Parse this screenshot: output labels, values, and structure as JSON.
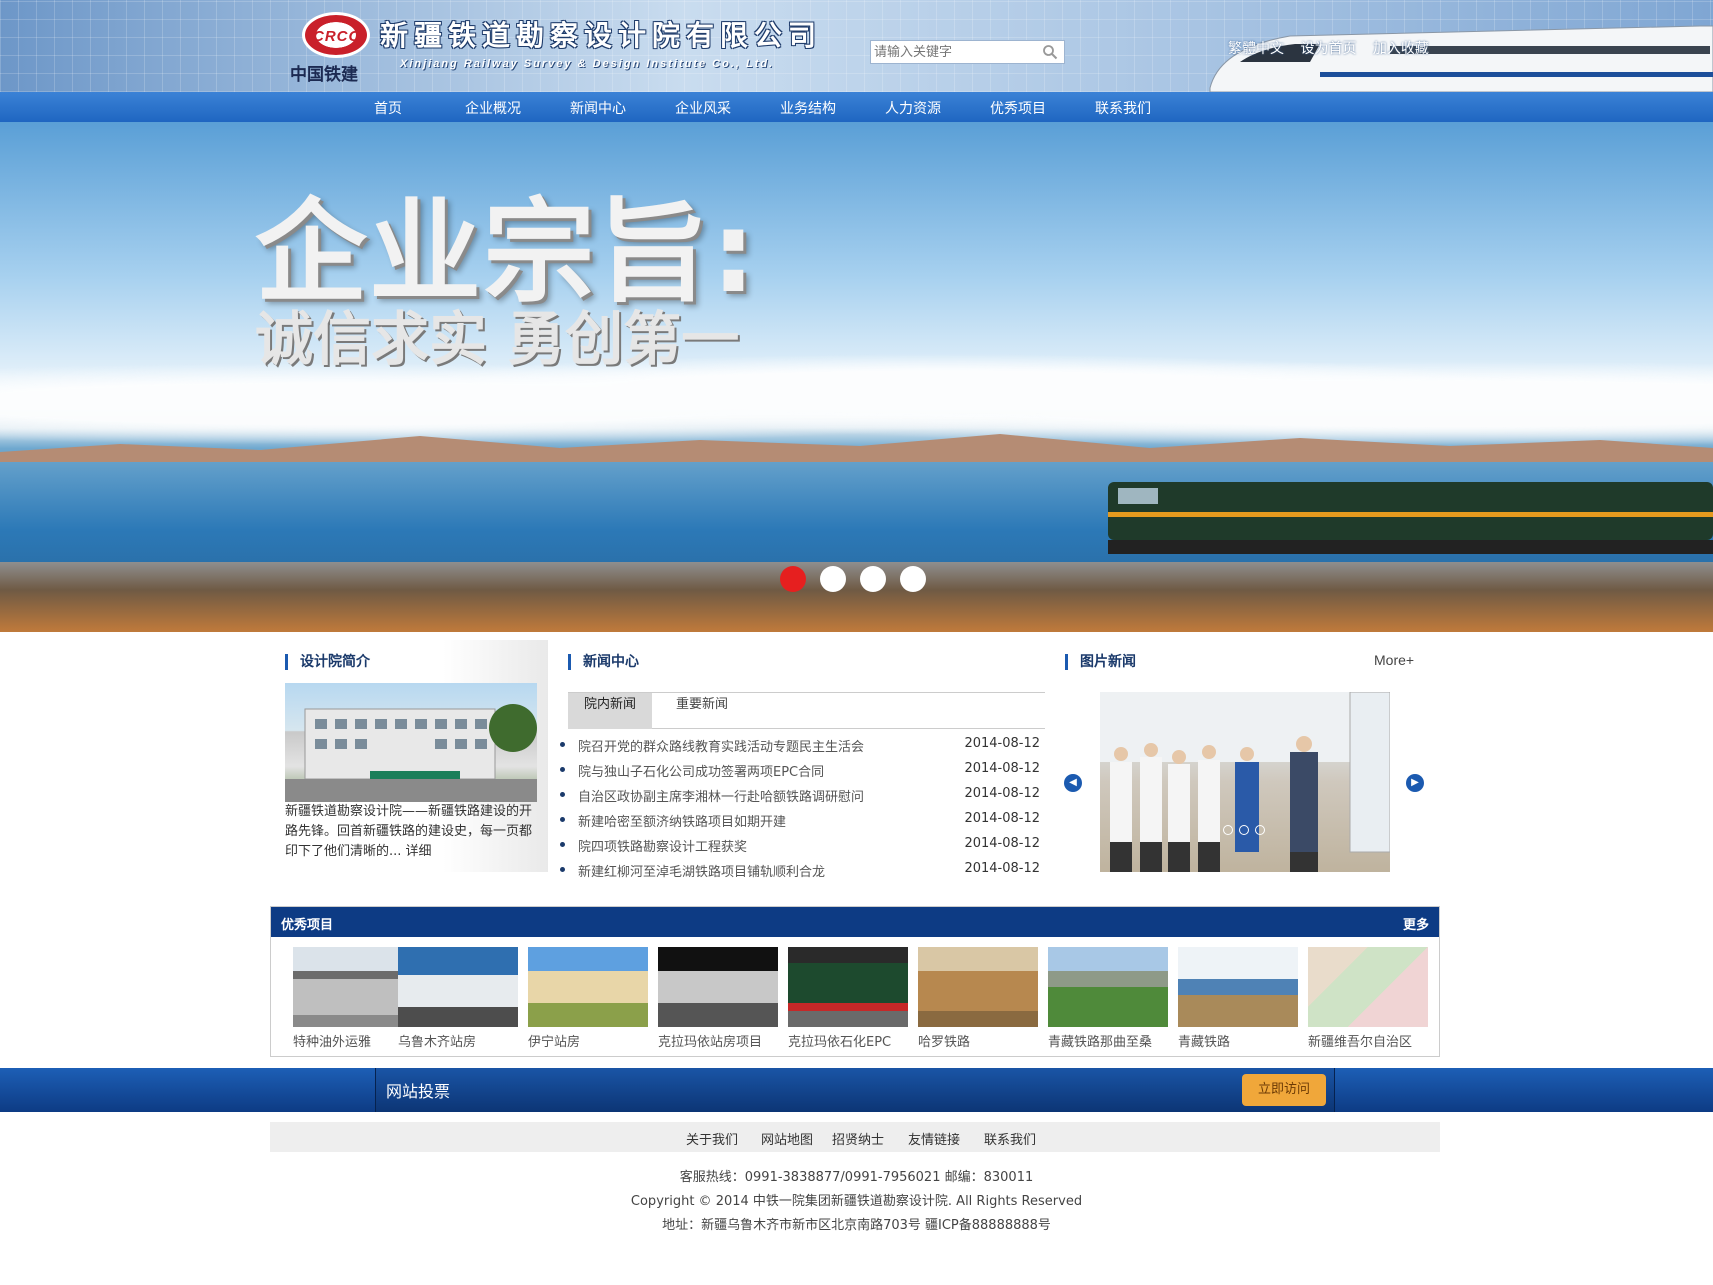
{
  "header": {
    "logo_abbr": "CRCC",
    "logo_cn": "中国铁建",
    "company_cn": "新疆铁道勘察设计院有限公司",
    "company_en": "Xinjiang Railway Survey & Design Institute Co., Ltd.",
    "search_placeholder": "请输入关键字",
    "links": [
      "繁體中文",
      "设为首页",
      "加入收藏"
    ]
  },
  "nav": [
    "首页",
    "企业概况",
    "新闻中心",
    "企业风采",
    "业务结构",
    "人力资源",
    "优秀项目",
    "联系我们"
  ],
  "banner": {
    "title": "企业宗旨:",
    "subtitle": "诚信求实 勇创第一",
    "active_slide": 0,
    "slides": 4
  },
  "about": {
    "title": "设计院简介",
    "text": "新疆铁道勘察设计院——新疆铁路建设的开路先锋。回首新疆铁路的建设史，每一页都印下了他们清晰的... 详细"
  },
  "news": {
    "title": "新闻中心",
    "tabs": [
      "院内新闻",
      "重要新闻"
    ],
    "items": [
      {
        "title": "院召开党的群众路线教育实践活动专题民主生活会",
        "date": "2014-08-12"
      },
      {
        "title": "院与独山子石化公司成功签署两项EPC合同",
        "date": "2014-08-12"
      },
      {
        "title": "自治区政协副主席李湘林一行赴哈额铁路调研慰问",
        "date": "2014-08-12"
      },
      {
        "title": "新建哈密至额济纳铁路项目如期开建",
        "date": "2014-08-12"
      },
      {
        "title": "院四项铁路勘察设计工程获奖",
        "date": "2014-08-12"
      },
      {
        "title": "新建红柳河至淖毛湖铁路项目铺轨顺利合龙",
        "date": "2014-08-12"
      }
    ]
  },
  "pic_news": {
    "title": "图片新闻",
    "more": "More+",
    "active_dot": 0
  },
  "projects": {
    "title": "优秀项目",
    "more": "更多",
    "items": [
      "特种油外运雅",
      "乌鲁木齐站房",
      "伊宁站房",
      "克拉玛依站房项目",
      "克拉玛依石化EPC",
      "哈罗铁路",
      "青藏铁路那曲至桑",
      "青藏铁路",
      "新疆维吾尔自治区"
    ]
  },
  "vote": {
    "title": "网站投票",
    "button": "立即访问"
  },
  "footer": {
    "links": [
      "关于我们",
      "网站地图",
      "招贤纳士",
      "友情链接",
      "联系我们"
    ],
    "hotline": "客服热线：0991-3838877/0991-7956021 邮编：830011",
    "copyright": "Copyright © 2014 中铁一院集团新疆铁道勘察设计院. All Rights Reserved",
    "address": "地址：新疆乌鲁木齐市新市区北京南路703号 疆ICP备88888888号"
  },
  "colors": {
    "nav_blue": "#1f66c1",
    "dark_blue": "#0d3b84",
    "accent_red": "#e61f1f",
    "button_orange": "#f0a73a"
  }
}
